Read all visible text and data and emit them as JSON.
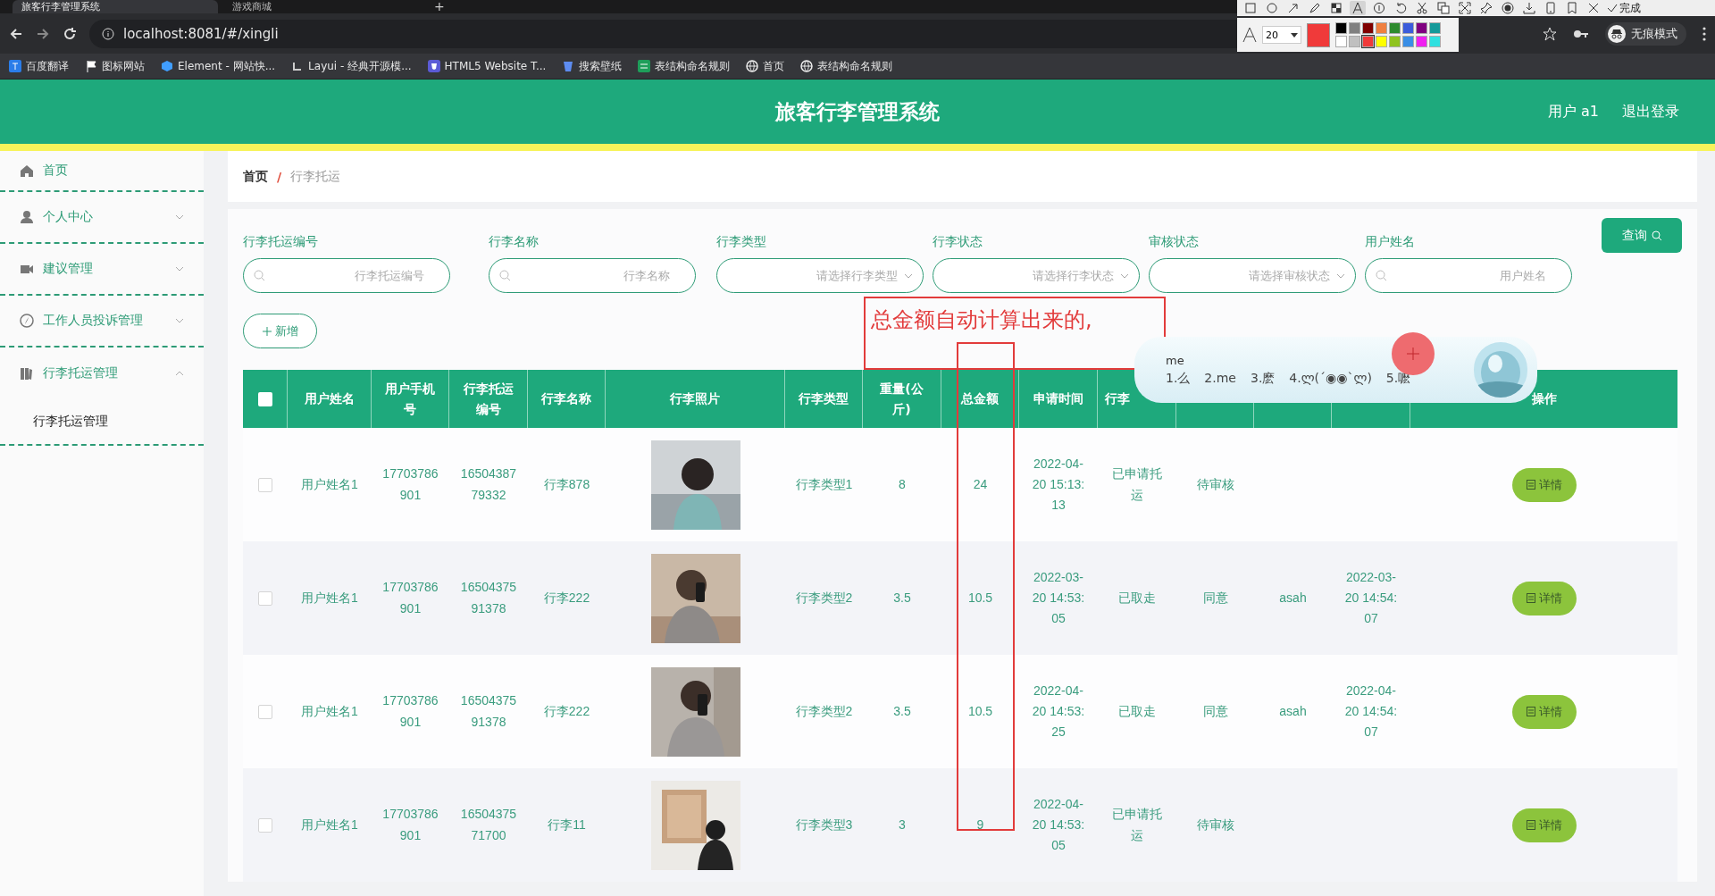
{
  "browser": {
    "tabs": [
      {
        "title": "旅客行李管理系统",
        "selected": true
      },
      {
        "title": "游戏商城",
        "selected": false
      }
    ],
    "new_tab": "+",
    "url": "localhost:8081/#/xingli",
    "profile": "无痕模式",
    "bookmarks": [
      "百度翻译",
      "图标网站",
      "Element - 网站快...",
      "Layui - 经典开源模...",
      "HTML5 Website T...",
      "搜索壁纸",
      "表结构命名规则",
      "首页",
      "表结构命名规则"
    ]
  },
  "capture_toolbar": {
    "tools": [
      {
        "kind": "rect",
        "selected": false
      },
      {
        "kind": "ellipse",
        "selected": false
      },
      {
        "kind": "arrow",
        "selected": false
      },
      {
        "kind": "pencil",
        "selected": false
      },
      {
        "kind": "mosaic",
        "selected": false
      },
      {
        "kind": "text",
        "selected": true
      },
      {
        "kind": "number",
        "selected": false
      },
      {
        "kind": "undo",
        "selected": false
      },
      {
        "kind": "scissors",
        "selected": false
      },
      {
        "kind": "translate",
        "selected": false
      },
      {
        "kind": "expand",
        "selected": false
      },
      {
        "kind": "pin",
        "selected": false
      },
      {
        "kind": "record",
        "selected": false
      },
      {
        "kind": "download",
        "selected": false
      },
      {
        "kind": "phone",
        "selected": false
      },
      {
        "kind": "bookmark",
        "selected": false
      },
      {
        "kind": "close",
        "selected": false
      }
    ],
    "done": "完成",
    "font_size": "20",
    "palette": [
      {
        "color": "#000000",
        "selected": false
      },
      {
        "color": "#808080",
        "selected": false
      },
      {
        "color": "#800000",
        "selected": false
      },
      {
        "color": "#f08040",
        "selected": false
      },
      {
        "color": "#2e8b2e",
        "selected": false
      },
      {
        "color": "#3b5bdb",
        "selected": false
      },
      {
        "color": "#800080",
        "selected": false
      },
      {
        "color": "#139999",
        "selected": false
      },
      {
        "color": "#ffffff",
        "selected": false
      },
      {
        "color": "#c0c0c0",
        "selected": false
      },
      {
        "color": "#f03a3a",
        "selected": true
      },
      {
        "color": "#ffff00",
        "selected": false
      },
      {
        "color": "#8fc31f",
        "selected": false
      },
      {
        "color": "#3a8ee6",
        "selected": false
      },
      {
        "color": "#f020f0",
        "selected": false
      },
      {
        "color": "#30e0e0",
        "selected": false
      }
    ]
  },
  "header": {
    "title": "旅客行李管理系统",
    "user": "用户 a1",
    "logout": "退出登录"
  },
  "sidebar": {
    "items": [
      {
        "label": "首页",
        "kind": "link"
      },
      {
        "label": "个人中心",
        "kind": "menu",
        "expanded": false
      },
      {
        "label": "建议管理",
        "kind": "menu",
        "expanded": false
      },
      {
        "label": "工作人员投诉管理",
        "kind": "menu",
        "expanded": false
      },
      {
        "label": "行李托运管理",
        "kind": "menu",
        "expanded": true,
        "children": [
          {
            "label": "行李托运管理"
          }
        ]
      }
    ]
  },
  "breadcrumb": [
    "首页",
    "行李托运"
  ],
  "breadcrumb_separator": "/",
  "filters": [
    {
      "label": "行李托运编号",
      "placeholder": "行李托运编号",
      "kind": "search"
    },
    {
      "label": "行李名称",
      "placeholder": "行李名称",
      "kind": "search"
    },
    {
      "label": "行李类型",
      "placeholder": "请选择行李类型",
      "kind": "select"
    },
    {
      "label": "行李状态",
      "placeholder": "请选择行李状态",
      "kind": "select"
    },
    {
      "label": "审核状态",
      "placeholder": "请选择审核状态",
      "kind": "select"
    },
    {
      "label": "用户姓名",
      "placeholder": "用户姓名",
      "kind": "search"
    }
  ],
  "query_button": "查询",
  "add_button": "新增",
  "table": {
    "all_selected": false,
    "columns": [
      {
        "label": "用户姓名"
      },
      {
        "label": "用户手机号"
      },
      {
        "label": "行李托运编号"
      },
      {
        "label": "行李名称"
      },
      {
        "label": "行李照片"
      },
      {
        "label": "行李类型"
      },
      {
        "label": "重量(公斤)"
      },
      {
        "label": "总金额"
      },
      {
        "label": "申请时间"
      },
      {
        "label": "行李"
      },
      {
        "label": "操作"
      }
    ],
    "rows": [
      {
        "selected": false,
        "cells": [
          "用户姓名1",
          "17703786901",
          "1650438779332",
          "行李878",
          {
            "kind": "picture"
          },
          "行李类型1",
          "8",
          "24",
          "2022-04-20 15:13:13",
          "已申请托运",
          "待审核",
          null,
          null
        ],
        "action": "详情"
      },
      {
        "selected": false,
        "cells": [
          "用户姓名1",
          "17703786901",
          "1650437591378",
          "行李222",
          {
            "kind": "picture"
          },
          "行李类型2",
          "3.5",
          "10.5",
          "2022-03-20 14:53:05",
          "已取走",
          "同意",
          "asah",
          "2022-03-20 14:54:07"
        ],
        "action": "详情"
      },
      {
        "selected": false,
        "cells": [
          "用户姓名1",
          "17703786901",
          "1650437591378",
          "行李222",
          {
            "kind": "picture"
          },
          "行李类型2",
          "3.5",
          "10.5",
          "2022-04-20 14:53:25",
          "已取走",
          "同意",
          "asah",
          "2022-04-20 14:54:07"
        ],
        "action": "详情"
      },
      {
        "selected": false,
        "cells": [
          "用户姓名1",
          "17703786901",
          "1650437571700",
          "行李11",
          {
            "kind": "picture"
          },
          "行李类型3",
          "3",
          "9",
          "2022-04-20 14:53:05",
          "已申请托运",
          "待审核",
          null,
          null
        ],
        "action": "详情"
      }
    ]
  },
  "annotations": [
    {
      "kind": "text_box",
      "text": "总金额自动计算出来的,"
    },
    {
      "kind": "rect"
    }
  ],
  "ime": {
    "input": "me",
    "candidates": [
      "1.么",
      "2.me",
      "3.麽",
      "4.ლ(´◉◉`ლ)",
      "5.嚒"
    ]
  }
}
